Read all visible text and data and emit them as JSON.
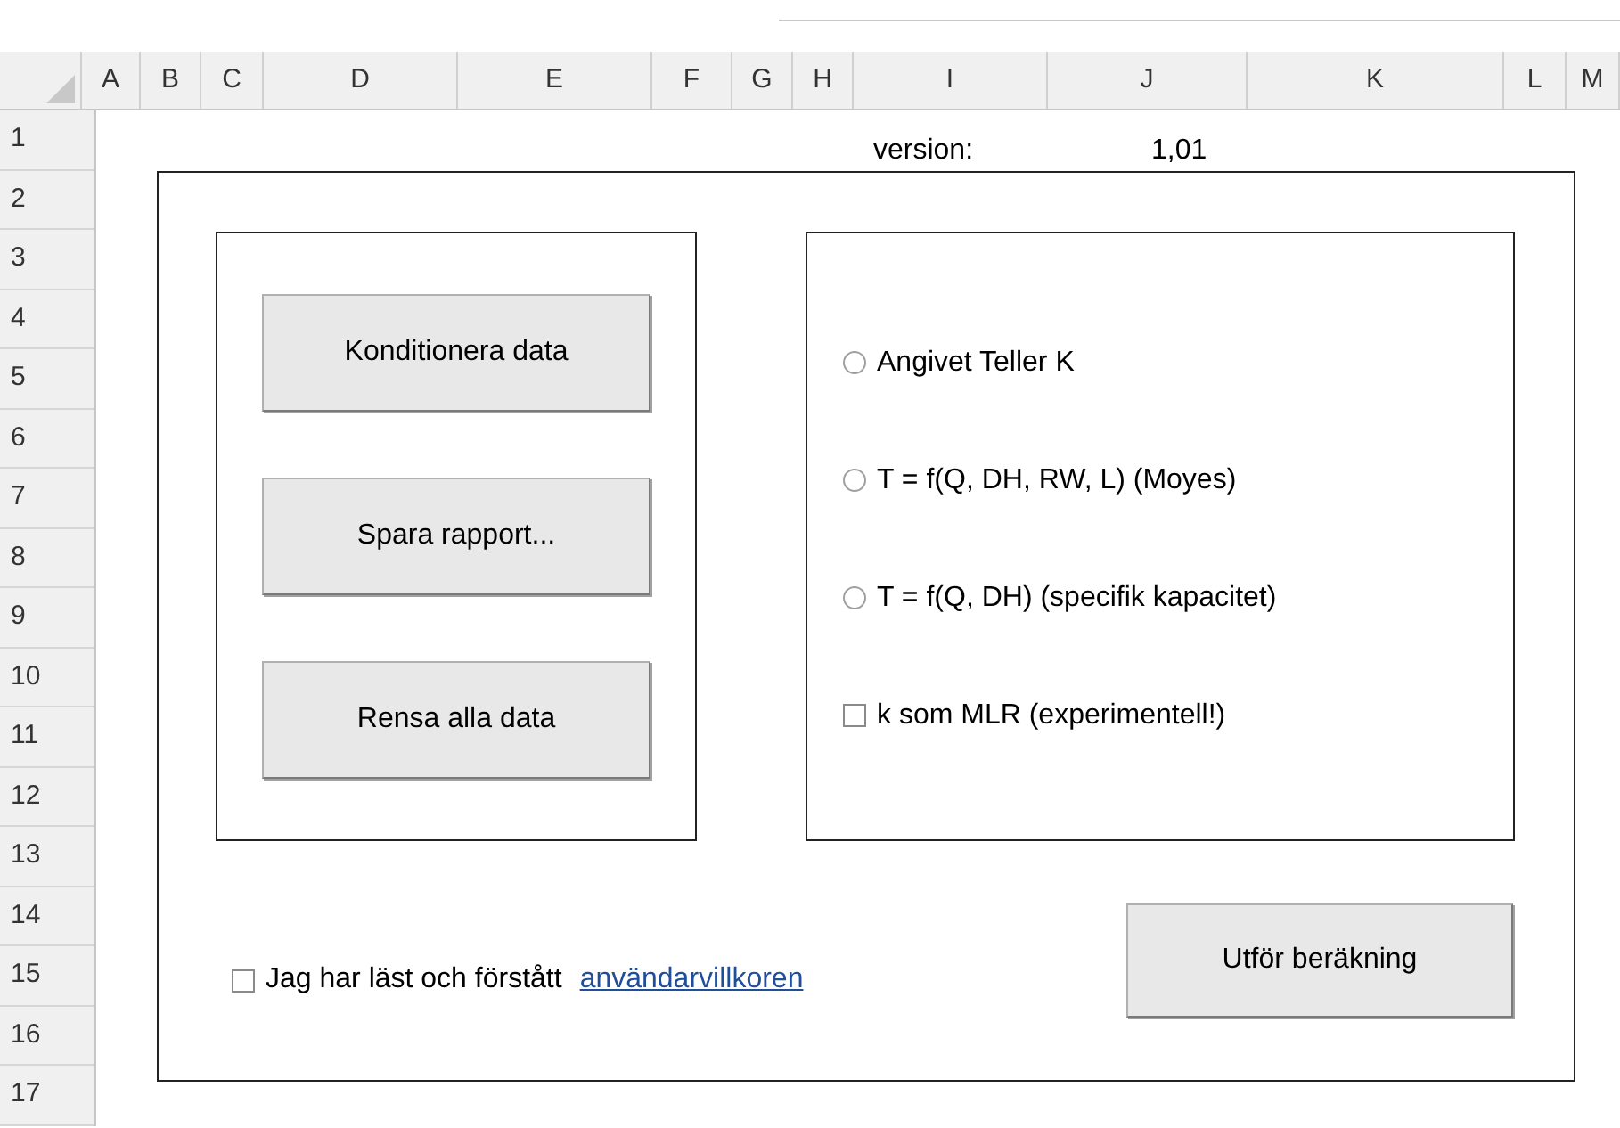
{
  "columns": [
    "A",
    "B",
    "C",
    "D",
    "E",
    "F",
    "G",
    "H",
    "I",
    "J",
    "K",
    "L",
    "M"
  ],
  "rows": [
    "1",
    "2",
    "3",
    "4",
    "5",
    "6",
    "7",
    "8",
    "9",
    "10",
    "11",
    "12",
    "13",
    "14",
    "15",
    "16",
    "17"
  ],
  "version": {
    "label": "version:",
    "value": "1,01"
  },
  "buttons": [
    "Konditionera data",
    "Spara rapport...",
    "Rensa alla data"
  ],
  "options": [
    {
      "kind": "radio",
      "label": "Angivet Teller K",
      "selected": false
    },
    {
      "kind": "radio",
      "label": "T = f(Q, DH, RW, L) (Moyes)",
      "selected": false
    },
    {
      "kind": "radio",
      "label": "T = f(Q, DH) (specifik kapacitet)",
      "selected": false
    },
    {
      "kind": "checkbox",
      "label": "k som MLR (experimentell!)",
      "checked": false
    }
  ],
  "terms": {
    "label": "Jag har läst och förstått",
    "link": "användarvillkoren",
    "checked": false
  },
  "submit_button": "Utför beräkning"
}
